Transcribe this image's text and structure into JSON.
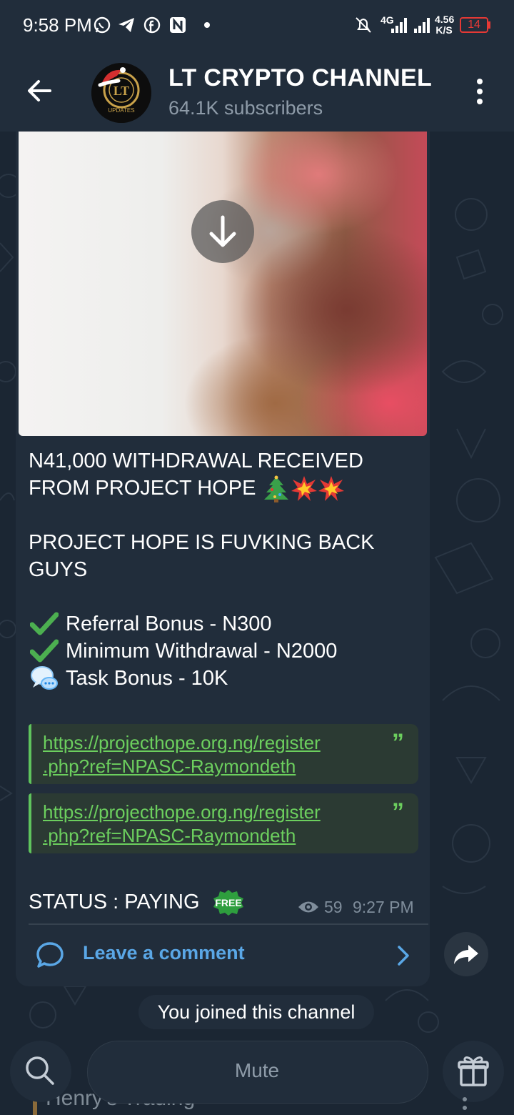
{
  "status_bar": {
    "time": "9:58 PM",
    "network": "4G",
    "speed_value": "4.56",
    "speed_unit": "K/S",
    "battery": "14"
  },
  "header": {
    "title": "LT CRYPTO CHANNEL",
    "subscribers": "64.1K subscribers",
    "avatar_caption": "UPDATES"
  },
  "message": {
    "line1": "N41,000 WITHDRAWAL RECEIVED",
    "line2": "FROM PROJECT HOPE",
    "line3": "PROJECT HOPE IS FUVKING BACK",
    "line4": "GUYS",
    "bullets": [
      {
        "icon": "check-icon",
        "text": "Referral Bonus - N300"
      },
      {
        "icon": "check-icon",
        "text": "Minimum Withdrawal - N2000"
      },
      {
        "icon": "speech-balloon-icon",
        "text": "Task Bonus - 10K"
      }
    ],
    "links": [
      {
        "line1": "https://projecthope.org.ng/register",
        "line2": ".php?ref=NPASC-Raymondeth"
      },
      {
        "line1": "https://projecthope.org.ng/register",
        "line2": ".php?ref=NPASC-Raymondeth"
      }
    ],
    "quote_mark": "”",
    "status_line": "STATUS : PAYING",
    "free_badge": "FREE",
    "views": "59",
    "time": "9:27 PM"
  },
  "comment": {
    "label": "Leave a comment"
  },
  "service": {
    "joined": "You joined this channel"
  },
  "bottom": {
    "peek_text": "Henry's Trading",
    "mute_label": "Mute"
  },
  "colors": {
    "background": "#1b2633",
    "bar": "#212d3b",
    "link_green": "#6ccf5e",
    "accent_blue": "#5aa7e6",
    "battery_red": "#e53935"
  }
}
